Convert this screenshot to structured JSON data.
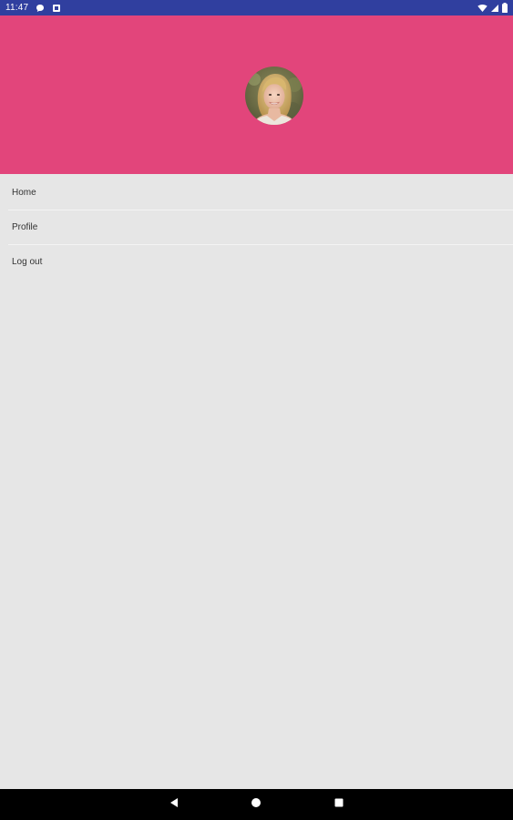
{
  "status_bar": {
    "time": "11:47",
    "icons": [
      "chat-bubble-icon",
      "notification-square-icon",
      "wifi-icon",
      "cellular-signal-icon",
      "battery-icon"
    ]
  },
  "header": {
    "background_color": "#e2457b",
    "avatar_icon": "user-avatar-photo"
  },
  "menu": {
    "items": [
      {
        "label": "Home"
      },
      {
        "label": "Profile"
      },
      {
        "label": "Log out"
      }
    ]
  },
  "nav_bar": {
    "buttons": [
      "back-triangle-icon",
      "home-circle-icon",
      "recents-square-icon"
    ]
  }
}
